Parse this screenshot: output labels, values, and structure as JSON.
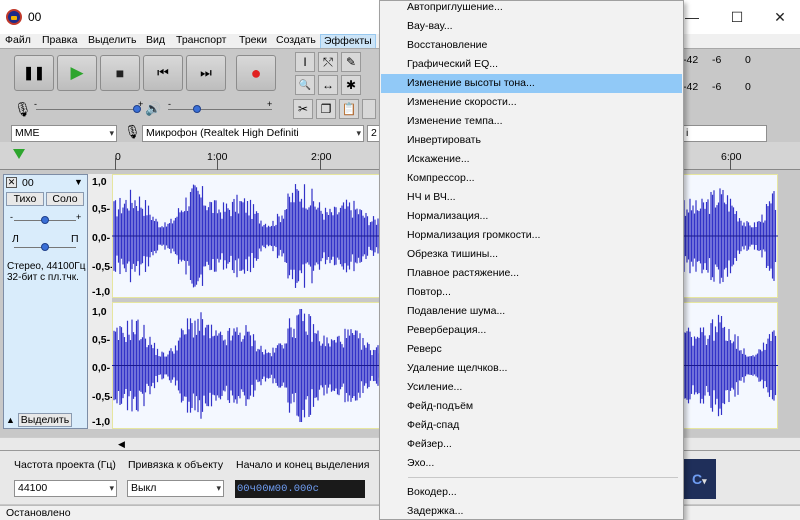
{
  "window": {
    "title": "00",
    "min": "—",
    "max": "☐",
    "close": "✕"
  },
  "menubar": [
    {
      "label": "Файл"
    },
    {
      "label": "Правка"
    },
    {
      "label": "Выделить"
    },
    {
      "label": "Вид"
    },
    {
      "label": "Транспорт"
    },
    {
      "label": "Треки"
    },
    {
      "label": "Создать"
    },
    {
      "label": "Эффекты"
    }
  ],
  "transport": {
    "pause": "❚❚",
    "play": "▶",
    "stop": "■",
    "skip_start": "⏮",
    "skip_end": "⏭",
    "record": "●"
  },
  "tools": {
    "select": "I",
    "envelope": "⤲",
    "draw": "✎",
    "zoom": "🔍",
    "timeshift": "↔",
    "multi": "✱"
  },
  "meter_ticks": {
    "a": "-42",
    "b": "-6",
    "c": "0"
  },
  "mixer": {
    "rec_minus": "-",
    "rec_plus": "+",
    "play_minus": "-",
    "play_plus": "+"
  },
  "device": {
    "host": "MME",
    "mic": "Микрофон (Realtek High Definiti",
    "channels": "2",
    "output_tail": "i"
  },
  "ruler": {
    "ticks": [
      "0",
      "1:00",
      "2:00",
      "6:00"
    ]
  },
  "track": {
    "name": "00",
    "mute": "Тихо",
    "solo": "Соло",
    "left": "Л",
    "right": "П",
    "info1": "Стерео, 44100Гц",
    "info2": "32-бит с пл.тчк.",
    "select": "Выделить"
  },
  "scale": [
    "1,0",
    "0,5-",
    "0,0-",
    "-0,5-",
    "-1,0",
    "1,0",
    "0,5-",
    "0,0-",
    "-0,5-",
    "-1,0"
  ],
  "selection_bar": {
    "rate_label": "Частота проекта (Гц)",
    "snap_label": "Привязка к объекту",
    "range_label": "Начало и конец выделения",
    "rate_value": "44100",
    "snap_value": "Выкл",
    "start_time": "00ч00м00.000с",
    "right_label": "С"
  },
  "status": "Остановлено",
  "effects_menu": {
    "items": [
      "Автоприглушение...",
      "Вау-вау...",
      "Восстановление",
      "Графический EQ...",
      "Изменение высоты тона...",
      "Изменение скорости...",
      "Изменение темпа...",
      "Инвертировать",
      "Искажение...",
      "Компрессор...",
      "НЧ и ВЧ...",
      "Нормализация...",
      "Нормализация громкости...",
      "Обрезка тишины...",
      "Плавное растяжение...",
      "Повтор...",
      "Подавление шума...",
      "Реверберация...",
      "Реверс",
      "Удаление щелчков...",
      "Усиление...",
      "Фейд-подъём",
      "Фейд-спад",
      "Фейзер...",
      "Эхо...",
      "Вокодер...",
      "Задержка..."
    ],
    "highlighted": "Изменение высоты тона..."
  },
  "colors": {
    "waveform": "#3232c8",
    "highlight": "#91c9f7",
    "play": "#2da52d",
    "record": "#e02020"
  }
}
